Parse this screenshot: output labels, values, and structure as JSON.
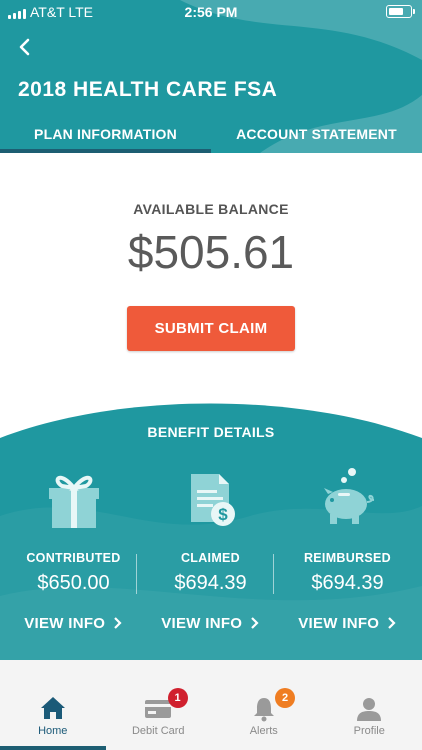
{
  "status_bar": {
    "carrier": "AT&T  LTE",
    "time": "2:56 PM"
  },
  "header": {
    "title": "2018 HEALTH CARE FSA",
    "tabs": [
      {
        "label": "PLAN INFORMATION",
        "active": true
      },
      {
        "label": "ACCOUNT STATEMENT",
        "active": false
      }
    ]
  },
  "balance": {
    "label": "AVAILABLE BALANCE",
    "value": "$505.61",
    "submit_label": "SUBMIT CLAIM"
  },
  "benefit_details": {
    "title": "BENEFIT DETAILS",
    "items": [
      {
        "icon": "gift-icon",
        "label": "CONTRIBUTED",
        "amount": "$650.00",
        "link": "VIEW INFO"
      },
      {
        "icon": "claim-document-icon",
        "label": "CLAIMED",
        "amount": "$694.39",
        "link": "VIEW INFO"
      },
      {
        "icon": "piggy-bank-icon",
        "label": "REIMBURSED",
        "amount": "$694.39",
        "link": "VIEW INFO"
      }
    ]
  },
  "nav": {
    "items": [
      {
        "label": "Home",
        "icon": "home-icon",
        "active": true
      },
      {
        "label": "Debit Card",
        "icon": "card-icon",
        "badge": "1"
      },
      {
        "label": "Alerts",
        "icon": "bell-icon",
        "badge": "2"
      },
      {
        "label": "Profile",
        "icon": "person-icon"
      }
    ]
  },
  "colors": {
    "teal": "#1f98a0",
    "dark_teal": "#1d5e72",
    "orange_button": "#ef5a3a",
    "badge_red": "#d0202e",
    "badge_orange": "#ef7d22"
  }
}
